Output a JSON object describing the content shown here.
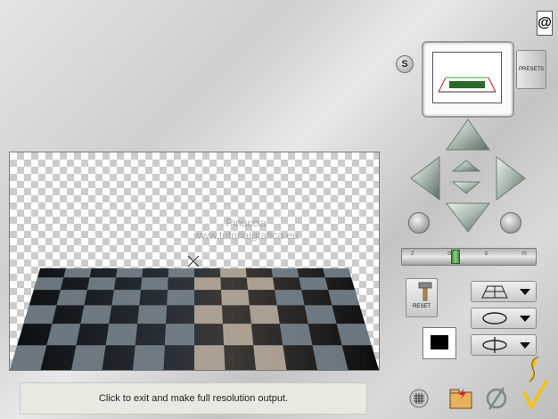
{
  "status_bar": {
    "message": "Click to exit and make full resolution output."
  },
  "canvas": {
    "watermark_line1": "Pinuccia",
    "watermark_line2": "www.tutorialgrafica.eu",
    "cursor": "crosshair-icon"
  },
  "presets": {
    "label": "PRESETS"
  },
  "s_button": {
    "label": "S"
  },
  "reset_button": {
    "label": "RESET"
  },
  "zoom": {
    "ticks": [
      "z",
      "o",
      "o",
      "m"
    ],
    "level": 0.4
  },
  "mode_buttons": [
    "grid-mode-icon",
    "rotate-mode-icon",
    "spin-mode-icon"
  ],
  "colors": {
    "background": "#d4d4d4",
    "arrow": "#a9b8ae",
    "zoom_thumb": "#3b8a3b",
    "status_bar": "#e9e9e1"
  }
}
